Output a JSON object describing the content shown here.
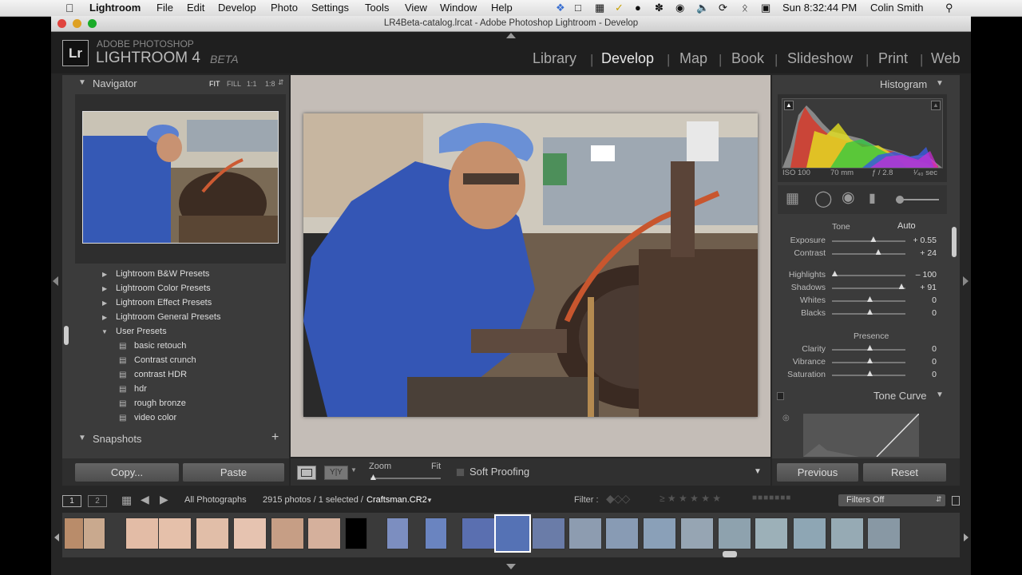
{
  "menubar": {
    "app": "Lightroom",
    "items": [
      "File",
      "Edit",
      "Develop",
      "Photo",
      "Settings",
      "Tools",
      "View",
      "Window",
      "Help"
    ],
    "clock": "Sun 8:32:44 PM",
    "user": "Colin Smith"
  },
  "window": {
    "title": "LR4Beta-catalog.lrcat - Adobe Photoshop Lightroom - Develop"
  },
  "branding": {
    "logo": "Lr",
    "line1": "ADOBE PHOTOSHOP",
    "line2": "LIGHTROOM 4",
    "beta": "BETA"
  },
  "modules": {
    "library": "Library",
    "develop": "Develop",
    "map": "Map",
    "book": "Book",
    "slideshow": "Slideshow",
    "print": "Print",
    "web": "Web",
    "active": "Develop"
  },
  "navigator": {
    "title": "Navigator",
    "fit": "FIT",
    "fill": "FILL",
    "one": "1:1",
    "ratio": "1:8"
  },
  "presets": [
    {
      "label": "Lightroom B&W Presets"
    },
    {
      "label": "Lightroom Color Presets"
    },
    {
      "label": "Lightroom Effect Presets"
    },
    {
      "label": "Lightroom General Presets"
    },
    {
      "label": "User Presets"
    }
  ],
  "user_presets": [
    "basic retouch",
    "Contrast crunch",
    "contrast HDR",
    "hdr",
    "rough bronze",
    "video color"
  ],
  "snapshots": {
    "title": "Snapshots",
    "add": "+"
  },
  "left_buttons": {
    "copy": "Copy...",
    "paste": "Paste"
  },
  "toolbar": {
    "zoom": "Zoom",
    "fit": "Fit",
    "soft_proofing": "Soft Proofing"
  },
  "histogram": {
    "title": "Histogram",
    "iso": "ISO 100",
    "focal": "70 mm",
    "aperture": "ƒ / 2.8",
    "shutter": "¹⁄₄₀ sec"
  },
  "tone": {
    "title": "Tone",
    "auto": "Auto",
    "sliders": [
      {
        "label": "Exposure",
        "value": "+ 0.55",
        "pos": 0.55
      },
      {
        "label": "Contrast",
        "value": "+ 24",
        "pos": 0.62
      },
      {
        "label": "Highlights",
        "value": "– 100",
        "pos": 0.0
      },
      {
        "label": "Shadows",
        "value": "+ 91",
        "pos": 0.95
      },
      {
        "label": "Whites",
        "value": "0",
        "pos": 0.5
      },
      {
        "label": "Blacks",
        "value": "0",
        "pos": 0.5
      }
    ]
  },
  "presence": {
    "title": "Presence",
    "sliders": [
      {
        "label": "Clarity",
        "value": "0",
        "pos": 0.5
      },
      {
        "label": "Vibrance",
        "value": "0",
        "pos": 0.5
      },
      {
        "label": "Saturation",
        "value": "0",
        "pos": 0.5
      }
    ]
  },
  "tone_curve": {
    "title": "Tone Curve"
  },
  "right_buttons": {
    "previous": "Previous",
    "reset": "Reset"
  },
  "filmstrip": {
    "source": "All Photographs",
    "count": "2915 photos / 1 selected /",
    "filename": "Craftsman.CR2",
    "filter_label": "Filter :",
    "filters_off": "Filters Off",
    "page1": "1",
    "page2": "2"
  },
  "colors": {
    "accent_blue": "#3c63c9",
    "panel": "#3f3f3f",
    "app_bg": "#262626"
  }
}
